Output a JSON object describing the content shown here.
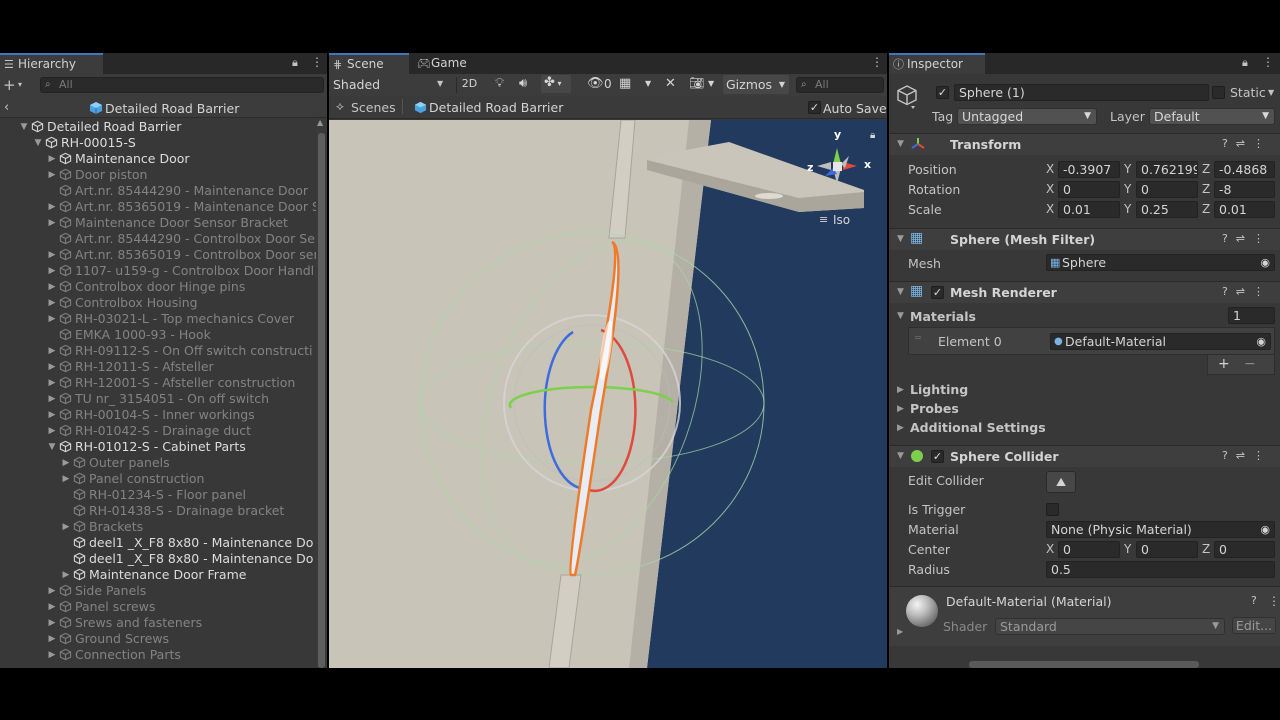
{
  "hierarchy": {
    "tab": "Hierarchy",
    "search_placeholder": "All",
    "scene_title": "Detailed Road Barrier",
    "items": [
      {
        "label": "Detailed Road Barrier",
        "depth": 0,
        "expanded": true,
        "dim": false
      },
      {
        "label": "RH-00015-S",
        "depth": 1,
        "expanded": true,
        "dim": false
      },
      {
        "label": "Maintenance Door",
        "depth": 2,
        "expanded": false,
        "dim": false
      },
      {
        "label": "Door piston",
        "depth": 2,
        "expanded": false,
        "dim": true
      },
      {
        "label": "Art.nr. 85444290 - Maintenance Door",
        "depth": 2,
        "leaf": true,
        "dim": true
      },
      {
        "label": "Art.nr. 85365019 - Maintenance Door S",
        "depth": 2,
        "expanded": false,
        "dim": true
      },
      {
        "label": "Maintenance Door Sensor Bracket",
        "depth": 2,
        "expanded": false,
        "dim": true
      },
      {
        "label": "Art.nr. 85444290 - Controlbox Door Se",
        "depth": 2,
        "leaf": true,
        "dim": true
      },
      {
        "label": "Art.nr. 85365019 - Controlbox Door ser",
        "depth": 2,
        "expanded": false,
        "dim": true
      },
      {
        "label": "1107- u159-g - Controlbox Door Handl",
        "depth": 2,
        "expanded": false,
        "dim": true
      },
      {
        "label": "Controlbox door Hinge pins",
        "depth": 2,
        "expanded": false,
        "dim": true
      },
      {
        "label": "Controlbox Housing",
        "depth": 2,
        "expanded": false,
        "dim": true
      },
      {
        "label": "RH-03021-L - Top mechanics Cover",
        "depth": 2,
        "expanded": false,
        "dim": true
      },
      {
        "label": "EMKA 1000-93 - Hook",
        "depth": 2,
        "leaf": true,
        "dim": true
      },
      {
        "label": "RH-09112-S - On Off switch constructi",
        "depth": 2,
        "expanded": false,
        "dim": true
      },
      {
        "label": "RH-12011-S - Afsteller",
        "depth": 2,
        "expanded": false,
        "dim": true
      },
      {
        "label": "RH-12001-S - Afsteller construction",
        "depth": 2,
        "expanded": false,
        "dim": true
      },
      {
        "label": "TU nr_ 3154051 - On off switch",
        "depth": 2,
        "expanded": false,
        "dim": true
      },
      {
        "label": "RH-00104-S - Inner workings",
        "depth": 2,
        "expanded": false,
        "dim": true
      },
      {
        "label": "RH-01042-S - Drainage duct",
        "depth": 2,
        "expanded": false,
        "dim": true
      },
      {
        "label": "RH-01012-S - Cabinet Parts",
        "depth": 2,
        "expanded": true,
        "dim": false
      },
      {
        "label": "Outer panels",
        "depth": 3,
        "expanded": false,
        "dim": true
      },
      {
        "label": "Panel construction",
        "depth": 3,
        "expanded": false,
        "dim": true
      },
      {
        "label": "RH-01234-S - Floor panel",
        "depth": 3,
        "leaf": true,
        "dim": true
      },
      {
        "label": "RH-01438-S - Drainage bracket",
        "depth": 3,
        "leaf": true,
        "dim": true
      },
      {
        "label": "Brackets",
        "depth": 3,
        "expanded": false,
        "dim": true
      },
      {
        "label": "deel1 _X_F8 8x80 - Maintenance Do",
        "depth": 3,
        "leaf": true,
        "dim": false
      },
      {
        "label": "deel1 _X_F8 8x80 - Maintenance Do",
        "depth": 3,
        "leaf": true,
        "dim": false
      },
      {
        "label": "Maintenance Door Frame",
        "depth": 3,
        "expanded": false,
        "dim": false
      },
      {
        "label": "Side Panels",
        "depth": 2,
        "expanded": false,
        "dim": true
      },
      {
        "label": "Panel screws",
        "depth": 2,
        "expanded": false,
        "dim": true
      },
      {
        "label": "Srews and fasteners",
        "depth": 2,
        "expanded": false,
        "dim": true
      },
      {
        "label": "Ground Screws",
        "depth": 2,
        "expanded": false,
        "dim": true
      },
      {
        "label": "Connection Parts",
        "depth": 2,
        "expanded": false,
        "dim": true
      }
    ]
  },
  "scene": {
    "tab_scene": "Scene",
    "tab_game": "Game",
    "shading": "Shaded",
    "mode_2d": "2D",
    "fx_count": "0",
    "gizmos": "Gizmos",
    "search_placeholder": "All",
    "breadcrumb_root": "Scenes",
    "breadcrumb_prefab": "Detailed Road Barrier",
    "auto_save": "Auto Save",
    "iso": "Iso",
    "axis_x": "x",
    "axis_y": "y",
    "axis_z": "z"
  },
  "inspector": {
    "tab": "Inspector",
    "object_name": "Sphere (1)",
    "static_label": "Static",
    "tag_label": "Tag",
    "tag_value": "Untagged",
    "layer_label": "Layer",
    "layer_value": "Default",
    "transform": {
      "title": "Transform",
      "position_label": "Position",
      "rotation_label": "Rotation",
      "scale_label": "Scale",
      "position": [
        "-0.3907",
        "0.762199",
        "-0.4868"
      ],
      "rotation": [
        "0",
        "0",
        "-8"
      ],
      "scale": [
        "0.01",
        "0.25",
        "0.01"
      ]
    },
    "mesh_filter": {
      "title": "Sphere (Mesh Filter)",
      "mesh_label": "Mesh",
      "mesh_value": "Sphere"
    },
    "mesh_renderer": {
      "title": "Mesh Renderer",
      "materials_label": "Materials",
      "materials_count": "1",
      "element_label": "Element 0",
      "element_value": "Default-Material",
      "lighting": "Lighting",
      "probes": "Probes",
      "additional": "Additional Settings"
    },
    "sphere_collider": {
      "title": "Sphere Collider",
      "edit_collider": "Edit Collider",
      "is_trigger": "Is Trigger",
      "material_label": "Material",
      "material_value": "None (Physic Material)",
      "center_label": "Center",
      "center": [
        "0",
        "0",
        "0"
      ],
      "radius_label": "Radius",
      "radius_value": "0.5"
    },
    "material": {
      "title": "Default-Material (Material)",
      "shader_label": "Shader",
      "shader_value": "Standard",
      "edit_label": "Edit..."
    },
    "axis_labels": [
      "X",
      "Y",
      "Z"
    ]
  }
}
